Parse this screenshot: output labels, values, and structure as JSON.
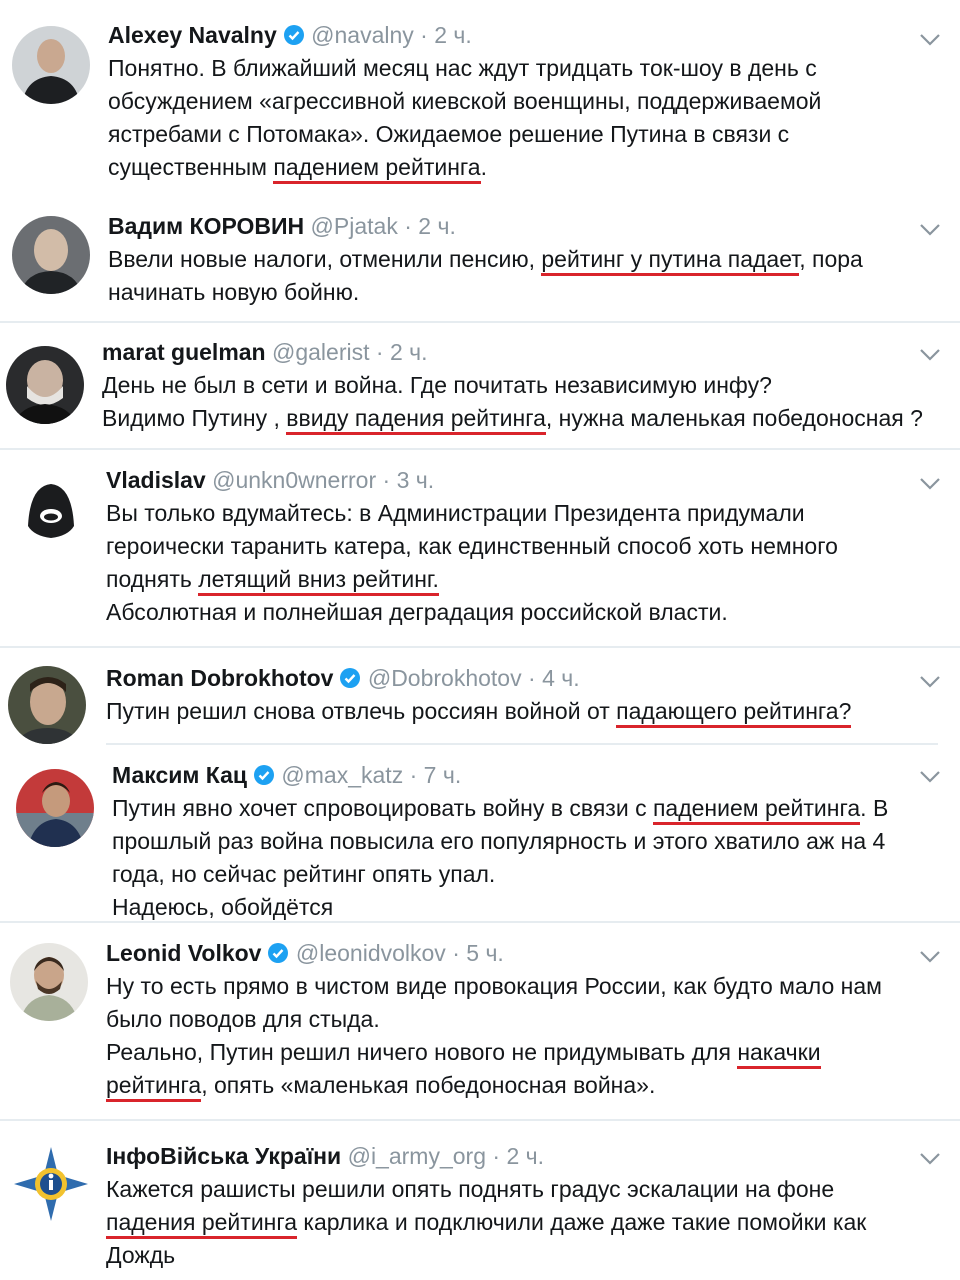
{
  "tweets": [
    {
      "name": "Alexey Navalny",
      "handle": "@navalny",
      "time": "2 ч.",
      "lines": [
        {
          "pre": "Понятно. В ближайший месяц нас ждут тридцать ток-шоу в день с",
          "ul": "",
          "post": ""
        },
        {
          "pre": "обсуждением «агрессивной киевской военщины, поддерживаемой",
          "ul": "",
          "post": ""
        },
        {
          "pre": "ястребами с Потомака». Ожидаемое решение Путина в связи с",
          "ul": "",
          "post": ""
        },
        {
          "pre": "существенным ",
          "ul": "падением рейтинга",
          "post": "."
        }
      ]
    },
    {
      "name": "Вадим КОРОВИН",
      "handle": "@Pjatak",
      "time": "2 ч.",
      "lines": [
        {
          "pre": "Ввели новые налоги, отменили пенсию, ",
          "ul": "рейтинг у путина падает",
          "post": ", пора"
        },
        {
          "pre": "начинать новую бойню.",
          "ul": "",
          "post": ""
        }
      ]
    },
    {
      "name": "marat guelman",
      "handle": "@galerist",
      "time": "2 ч.",
      "lines": [
        {
          "pre": "День не был в сети и война. Где почитать независимую инфу?",
          "ul": "",
          "post": ""
        },
        {
          "pre": "Видимо Путину , ",
          "ul": "ввиду падения рейтинга",
          "post": ", нужна маленькая победоносная ?"
        }
      ]
    },
    {
      "name": "Vladislav",
      "handle": "@unkn0wnerror",
      "time": "3 ч.",
      "lines": [
        {
          "pre": "Вы только вдумайтесь: в Администрации Президента придумали",
          "ul": "",
          "post": ""
        },
        {
          "pre": "героически таранить катера, как единственный способ хоть немного",
          "ul": "",
          "post": ""
        },
        {
          "pre": "поднять ",
          "ul": "летящий вниз рейтинг.",
          "post": ""
        },
        {
          "pre": "Абсолютная и полнейшая деградация российской власти.",
          "ul": "",
          "post": ""
        }
      ]
    },
    {
      "name": "Roman Dobrokhotov",
      "handle": "@Dobrokhotov",
      "time": "4 ч.",
      "lines": [
        {
          "pre": "Путин решил снова отвлечь россиян войной от ",
          "ul": "падающего рейтинга?",
          "post": ""
        }
      ]
    },
    {
      "name": "Максим Кац",
      "handle": "@max_katz",
      "time": "7 ч.",
      "lines": [
        {
          "pre": "Путин явно хочет спровоцировать войну в связи с ",
          "ul": "падением рейтинга",
          "post": ". В"
        },
        {
          "pre": "прошлый раз война повысила его популярность и этого хватило аж на 4",
          "ul": "",
          "post": ""
        },
        {
          "pre": "года, но сейчас рейтинг опять упал.",
          "ul": "",
          "post": ""
        },
        {
          "pre": "Надеюсь, обойдётся",
          "ul": "",
          "post": ""
        }
      ]
    },
    {
      "name": "Leonid Volkov",
      "handle": "@leonidvolkov",
      "time": "5 ч.",
      "lines": [
        {
          "pre": "Ну то есть прямо в чистом виде провокация России, как будто мало нам",
          "ul": "",
          "post": ""
        },
        {
          "pre": "было поводов для стыда.",
          "ul": "",
          "post": ""
        },
        {
          "pre": "Реально, Путин решил ничего нового не придумывать для ",
          "ul": "накачки",
          "post": ""
        },
        {
          "pre": "",
          "ul": "рейтинга",
          "post": ", опять «маленькая победоносная война»."
        }
      ]
    },
    {
      "name": "ІнфоВійська України",
      "handle": "@i_army_org",
      "time": "2 ч.",
      "lines": [
        {
          "pre": "Кажется рашисты решили опять поднять градус эскалации на фоне",
          "ul": "",
          "post": ""
        },
        {
          "pre": "",
          "ul": "падения рейтинга",
          "post": " карлика и подключили даже даже такие помойки как"
        },
        {
          "pre": "Дождь",
          "ul": "",
          "post": ""
        }
      ]
    }
  ],
  "separator": " · ",
  "colors": {
    "underline": "#d9242b",
    "verified": "#1da1f2",
    "muted": "#8a959e"
  }
}
